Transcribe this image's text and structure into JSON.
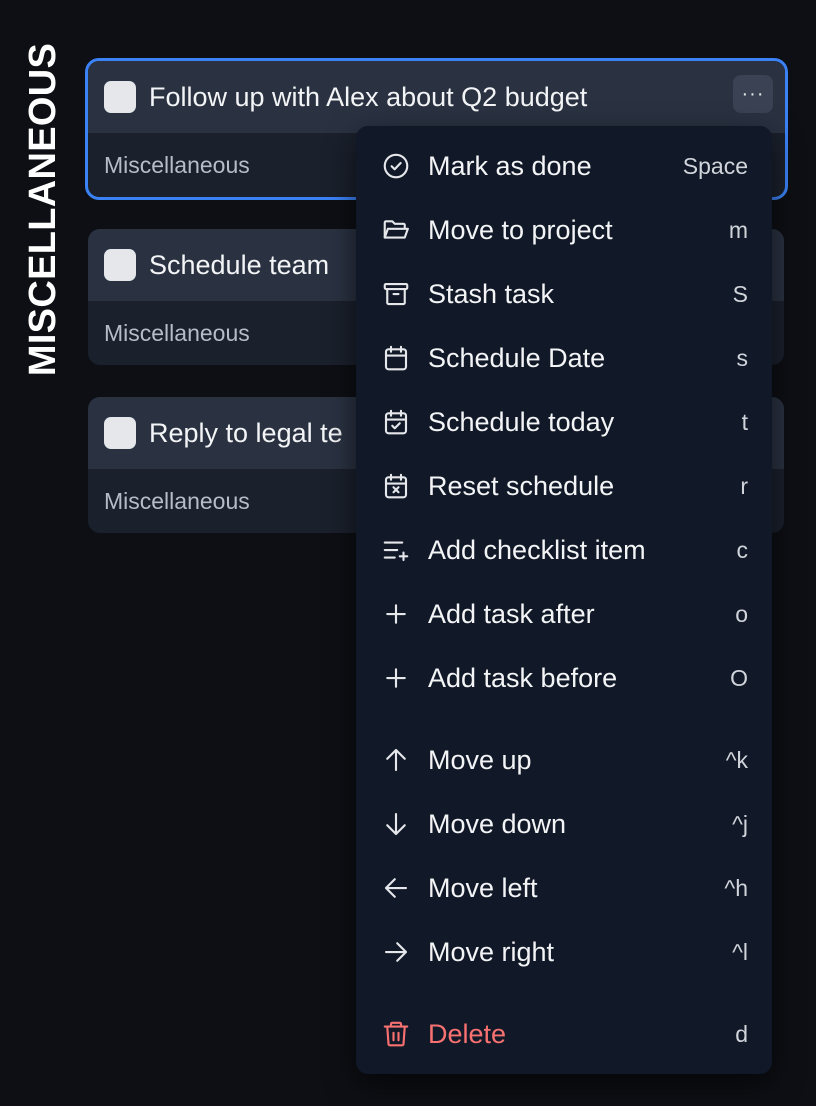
{
  "column": {
    "title": "MISCELLANEOUS"
  },
  "cards": [
    {
      "title": "Follow up with Alex about Q2 budget",
      "project": "Miscellaneous",
      "more_label": "···"
    },
    {
      "title": "Schedule team",
      "project": "Miscellaneous"
    },
    {
      "title": "Reply to legal te",
      "project": "Miscellaneous"
    }
  ],
  "menu": {
    "items": [
      {
        "label": "Mark as done",
        "key": "Space",
        "icon": "check-circle-icon"
      },
      {
        "label": "Move to project",
        "key": "m",
        "icon": "folder-open-icon"
      },
      {
        "label": "Stash task",
        "key": "S",
        "icon": "archive-icon"
      },
      {
        "label": "Schedule Date",
        "key": "s",
        "icon": "calendar-icon"
      },
      {
        "label": "Schedule today",
        "key": "t",
        "icon": "calendar-check-icon"
      },
      {
        "label": "Reset schedule",
        "key": "r",
        "icon": "calendar-x-icon"
      },
      {
        "label": "Add checklist item",
        "key": "c",
        "icon": "list-plus-icon"
      },
      {
        "label": "Add task after",
        "key": "o",
        "icon": "plus-icon"
      },
      {
        "label": "Add task before",
        "key": "O",
        "icon": "plus-icon"
      },
      {
        "label": "Move up",
        "key": "^k",
        "icon": "arrow-up-icon"
      },
      {
        "label": "Move down",
        "key": "^j",
        "icon": "arrow-down-icon"
      },
      {
        "label": "Move left",
        "key": "^h",
        "icon": "arrow-left-icon"
      },
      {
        "label": "Move right",
        "key": "^l",
        "icon": "arrow-right-icon"
      },
      {
        "label": "Delete",
        "key": "d",
        "icon": "trash-icon"
      }
    ]
  },
  "colors": {
    "background": "#0d0f14",
    "card": "#1a202c",
    "card_header": "#2a3242",
    "selection": "#3b82f6",
    "menu": "#111827",
    "danger": "#f87171"
  }
}
